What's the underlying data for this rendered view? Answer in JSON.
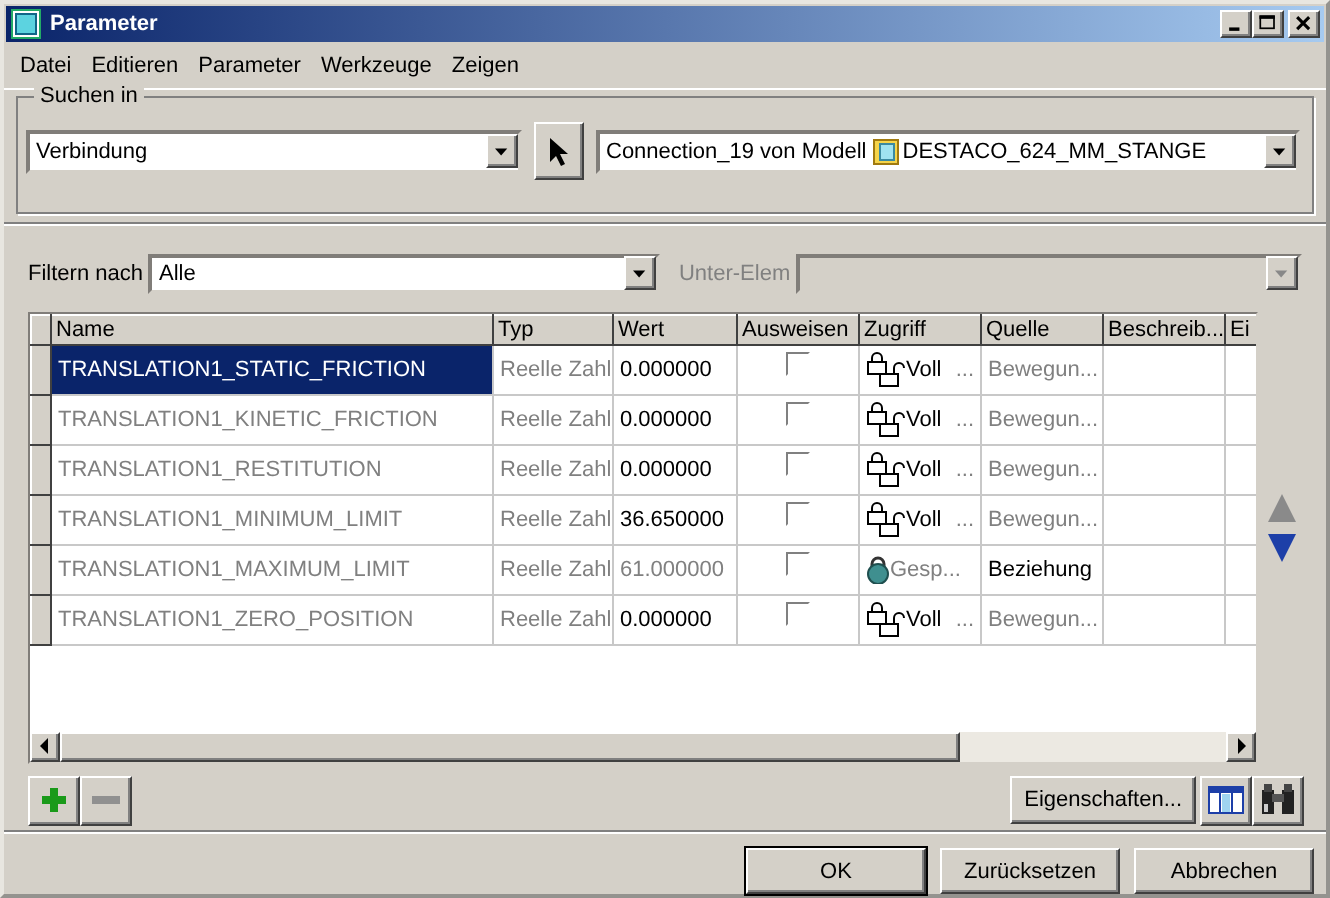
{
  "window": {
    "title": "Parameter"
  },
  "menu": [
    "Datei",
    "Editieren",
    "Parameter",
    "Werkzeuge",
    "Zeigen"
  ],
  "search": {
    "label": "Suchen in",
    "type_value": "Verbindung",
    "object_value": "Connection_19 von Modell",
    "model_value": "DESTACO_624_MM_STANGE"
  },
  "filter": {
    "label": "Filtern nach",
    "value": "Alle",
    "sub_label": "Unter-Elem",
    "sub_disabled": true
  },
  "table": {
    "columns": [
      "Name",
      "Typ",
      "Wert",
      "Ausweisen",
      "Zugriff",
      "Quelle",
      "Beschreib...",
      "Ei"
    ],
    "rows": [
      {
        "name": "TRANSLATION1_STATIC_FRICTION",
        "type": "Reelle Zahl",
        "value": "0.000000",
        "shown": false,
        "kind": "full",
        "access": "Voll",
        "access_more": "...",
        "source": "Bewegun...",
        "selected": true
      },
      {
        "name": "TRANSLATION1_KINETIC_FRICTION",
        "type": "Reelle Zahl",
        "value": "0.000000",
        "shown": false,
        "kind": "full",
        "access": "Voll",
        "access_more": "...",
        "source": "Bewegun...",
        "selected": false
      },
      {
        "name": "TRANSLATION1_RESTITUTION",
        "type": "Reelle Zahl",
        "value": "0.000000",
        "shown": false,
        "kind": "full",
        "access": "Voll",
        "access_more": "...",
        "source": "Bewegun...",
        "selected": false
      },
      {
        "name": "TRANSLATION1_MINIMUM_LIMIT",
        "type": "Reelle Zahl",
        "value": "36.650000",
        "shown": false,
        "kind": "full",
        "access": "Voll",
        "access_more": "...",
        "source": "Bewegun...",
        "selected": false
      },
      {
        "name": "TRANSLATION1_MAXIMUM_LIMIT",
        "type": "Reelle Zahl",
        "value": "61.000000",
        "shown": false,
        "kind": "locked",
        "access": "Gesp...",
        "source": "Beziehung",
        "selected": false
      },
      {
        "name": "TRANSLATION1_ZERO_POSITION",
        "type": "Reelle Zahl",
        "value": "0.000000",
        "shown": false,
        "kind": "full",
        "access": "Voll",
        "access_more": "...",
        "source": "Bewegun...",
        "selected": false
      }
    ]
  },
  "properties_button": "Eigenschaften...",
  "dialog_buttons": [
    "OK",
    "Zurücksetzen",
    "Abbrechen"
  ]
}
